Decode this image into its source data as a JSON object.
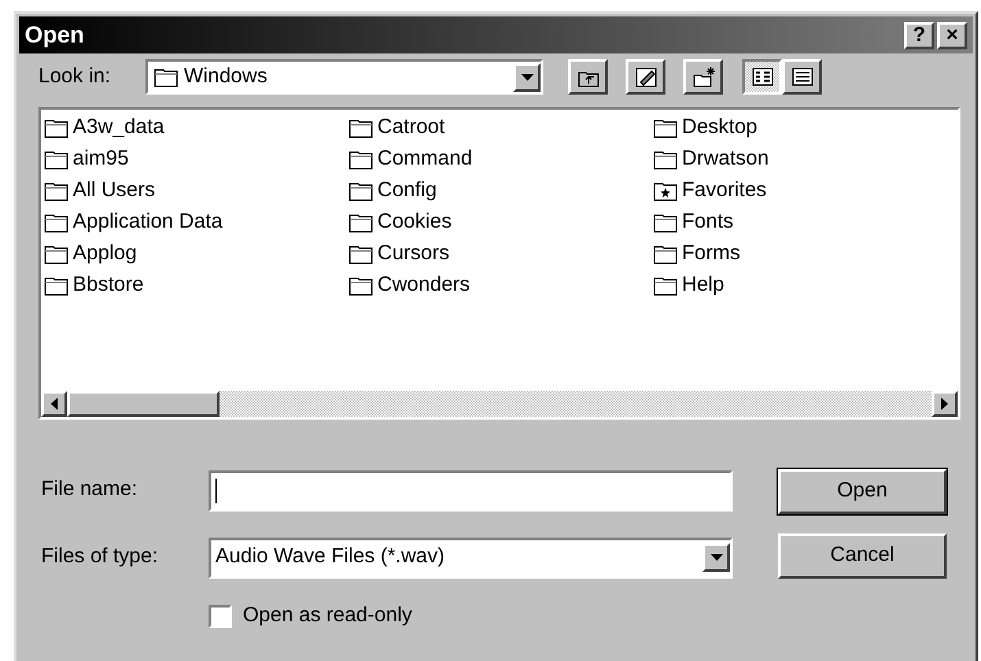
{
  "window": {
    "title": "Open",
    "buttons": [
      "?",
      "×"
    ]
  },
  "look_in": {
    "label": "Look in:",
    "value": "Windows"
  },
  "view_buttons": [
    {
      "selected": true
    },
    {
      "selected": false
    }
  ],
  "files": [
    {
      "name": "A3w_data",
      "kind": "folder"
    },
    {
      "name": "aim95",
      "kind": "folder"
    },
    {
      "name": "All Users",
      "kind": "folder"
    },
    {
      "name": "Application Data",
      "kind": "folder"
    },
    {
      "name": "Applog",
      "kind": "folder"
    },
    {
      "name": "Bbstore",
      "kind": "folder"
    },
    {
      "name": "Catroot",
      "kind": "folder"
    },
    {
      "name": "Command",
      "kind": "folder"
    },
    {
      "name": "Config",
      "kind": "folder"
    },
    {
      "name": "Cookies",
      "kind": "folder"
    },
    {
      "name": "Cursors",
      "kind": "folder"
    },
    {
      "name": "Cwonders",
      "kind": "folder"
    },
    {
      "name": "Desktop",
      "kind": "folder"
    },
    {
      "name": "Drwatson",
      "kind": "folder"
    },
    {
      "name": "Favorites",
      "kind": "favorites"
    },
    {
      "name": "Fonts",
      "kind": "folder"
    },
    {
      "name": "Forms",
      "kind": "folder"
    },
    {
      "name": "Help",
      "kind": "folder"
    }
  ],
  "file_name": {
    "label": "File name:"
  },
  "file_type": {
    "label": "Files of type:",
    "value": "Audio Wave Files (*.wav)"
  },
  "read_only": {
    "label": "Open as read-only",
    "checked": false
  },
  "buttons": [
    "Open",
    "Cancel"
  ]
}
